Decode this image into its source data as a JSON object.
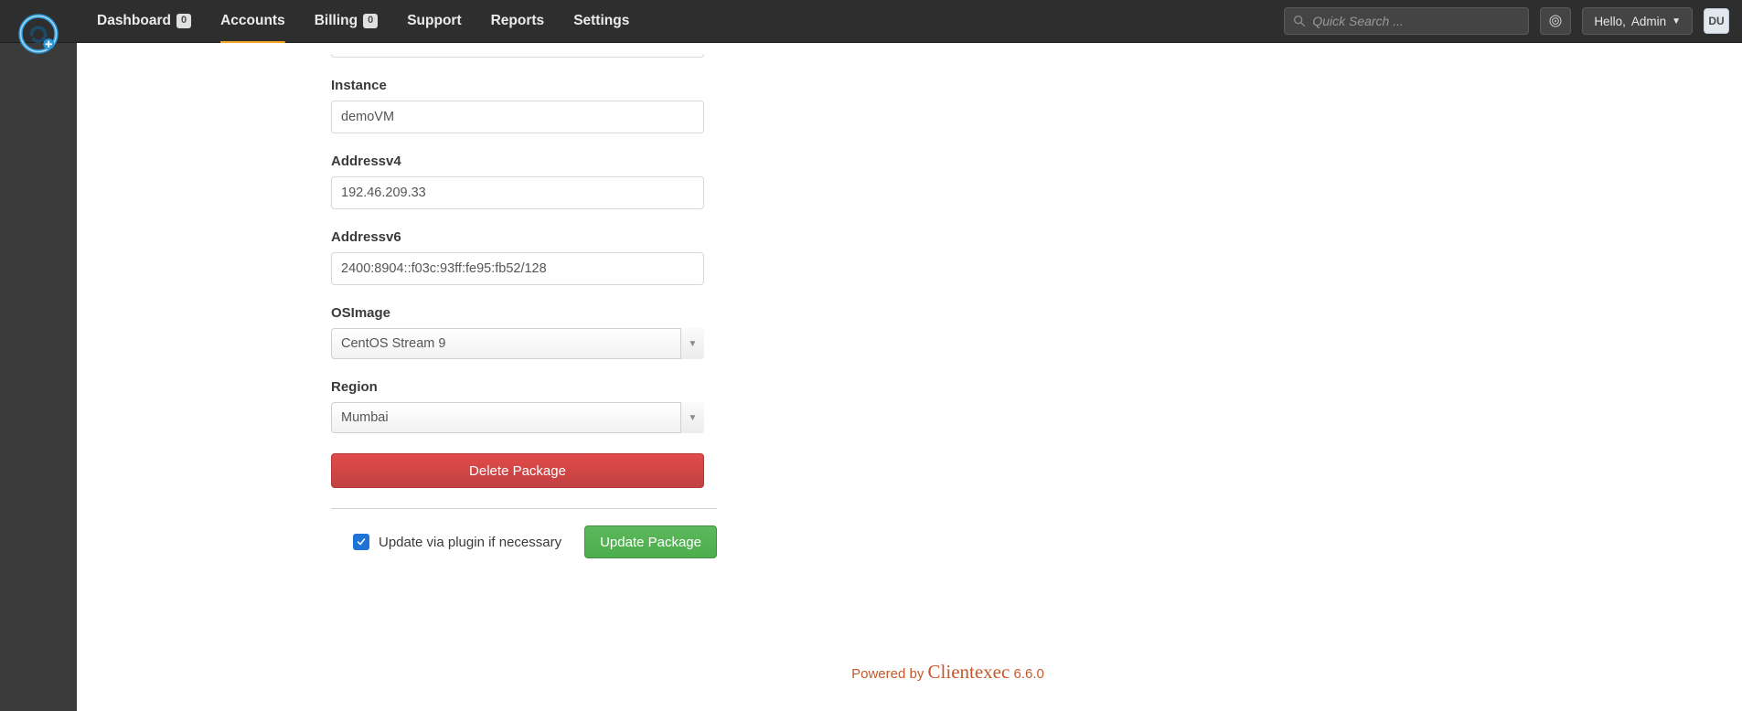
{
  "nav": {
    "items": [
      {
        "label": "Dashboard",
        "badge": "0",
        "active": false
      },
      {
        "label": "Accounts",
        "badge": null,
        "active": true
      },
      {
        "label": "Billing",
        "badge": "0",
        "active": false
      },
      {
        "label": "Support",
        "badge": null,
        "active": false
      },
      {
        "label": "Reports",
        "badge": null,
        "active": false
      },
      {
        "label": "Settings",
        "badge": null,
        "active": false
      }
    ],
    "search_placeholder": "Quick Search ...",
    "hello_prefix": "Hello,",
    "hello_name": "Admin",
    "avatar_initials": "DU"
  },
  "form": {
    "instance": {
      "label": "Instance",
      "value": "demoVM"
    },
    "addressv4": {
      "label": "Addressv4",
      "value": "192.46.209.33"
    },
    "addressv6": {
      "label": "Addressv6",
      "value": "2400:8904::f03c:93ff:fe95:fb52/128"
    },
    "osimage": {
      "label": "OSImage",
      "selected": "CentOS Stream 9"
    },
    "region": {
      "label": "Region",
      "selected": "Mumbai"
    },
    "delete_label": "Delete Package",
    "update_check_label": "Update via plugin if necessary",
    "update_check_checked": true,
    "update_button_label": "Update Package"
  },
  "footer": {
    "powered_by": "Powered by",
    "brand": "Clientexec",
    "version": "6.6.0"
  }
}
